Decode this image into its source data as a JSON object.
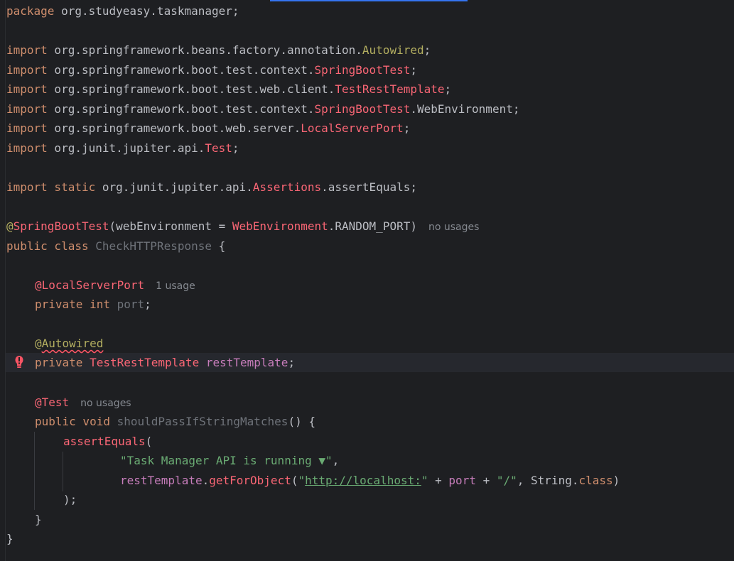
{
  "editor": {
    "lines": {
      "package": {
        "kw": "package",
        "rest": " org.studyeasy.taskmanager;"
      },
      "import1": {
        "kw": "import",
        "pkg": " org.springframework.beans.factory.annotation.",
        "cls": "Autowired",
        "end": ";"
      },
      "import2": {
        "kw": "import",
        "pkg": " org.springframework.boot.test.context.",
        "cls": "SpringBootTest",
        "end": ";"
      },
      "import3": {
        "kw": "import",
        "pkg": " org.springframework.boot.test.web.client.",
        "cls": "TestRestTemplate",
        "end": ";"
      },
      "import4": {
        "kw": "import",
        "pkg": " org.springframework.boot.test.context.",
        "cls": "SpringBootTest",
        "end": ".WebEnvironment;"
      },
      "import5": {
        "kw": "import",
        "pkg": " org.springframework.boot.web.server.",
        "cls": "LocalServerPort",
        "end": ";"
      },
      "import6": {
        "kw": "import",
        "pkg": " org.junit.jupiter.api.",
        "cls": "Test",
        "end": ";"
      },
      "import_static": {
        "kw": "import static",
        "pkg": " org.junit.jupiter.api.",
        "cls": "Assertions",
        "end": ".assertEquals;"
      },
      "class_annotation": {
        "at": "@",
        "name": "SpringBootTest",
        "open": "(webEnvironment = ",
        "enum_cls": "WebEnvironment",
        "enum_val": ".RANDOM_PORT)",
        "hint": "no usages"
      },
      "class_decl": {
        "kw": "public class",
        "name": "CheckHTTPResponse",
        "brace": " {"
      },
      "port_annotation": {
        "name": "@LocalServerPort",
        "hint": "1 usage"
      },
      "port_field": {
        "kw": "private int",
        "name": "port",
        "end": ";"
      },
      "autowired_annotation": {
        "at": "@",
        "name": "Autowired"
      },
      "template_field": {
        "kw": "private",
        "type": "TestRestTemplate",
        "name": "restTemplate",
        "end": ";"
      },
      "test_annotation": {
        "name": "@Test",
        "hint": "no usages"
      },
      "method_decl": {
        "kw": "public void",
        "name": "shouldPassIfStringMatches",
        "end": "() {"
      },
      "assert_call": {
        "name": "assertEquals",
        "end": "("
      },
      "expected_arg": {
        "str": "\"Task Manager API is running ▼\"",
        "end": ","
      },
      "actual_arg": {
        "obj": "restTemplate",
        "dot": ".",
        "method": "getForObject",
        "open": "(",
        "q1": "\"",
        "url": "http://localhost:",
        "q2": "\"",
        "plus1": " + ",
        "var": "port",
        "plus2": " + ",
        "slash": "\"/\"",
        "comma": ", String.",
        "cls_kw": "class",
        "close": ")"
      },
      "close_paren": {
        "text": ");"
      },
      "close_method": {
        "text": "}"
      },
      "close_class": {
        "text": "}"
      }
    },
    "error_icon": "error-bulb-icon",
    "colors": {
      "background": "#1e1f22",
      "keyword": "#cf8e6d",
      "annotation": "#b3ae60",
      "class_reference": "#fa6675",
      "string": "#6aab73",
      "field": "#c77dbb",
      "default_text": "#bcbec4",
      "inlay_hint": "#868a91",
      "error": "#f75464"
    }
  }
}
